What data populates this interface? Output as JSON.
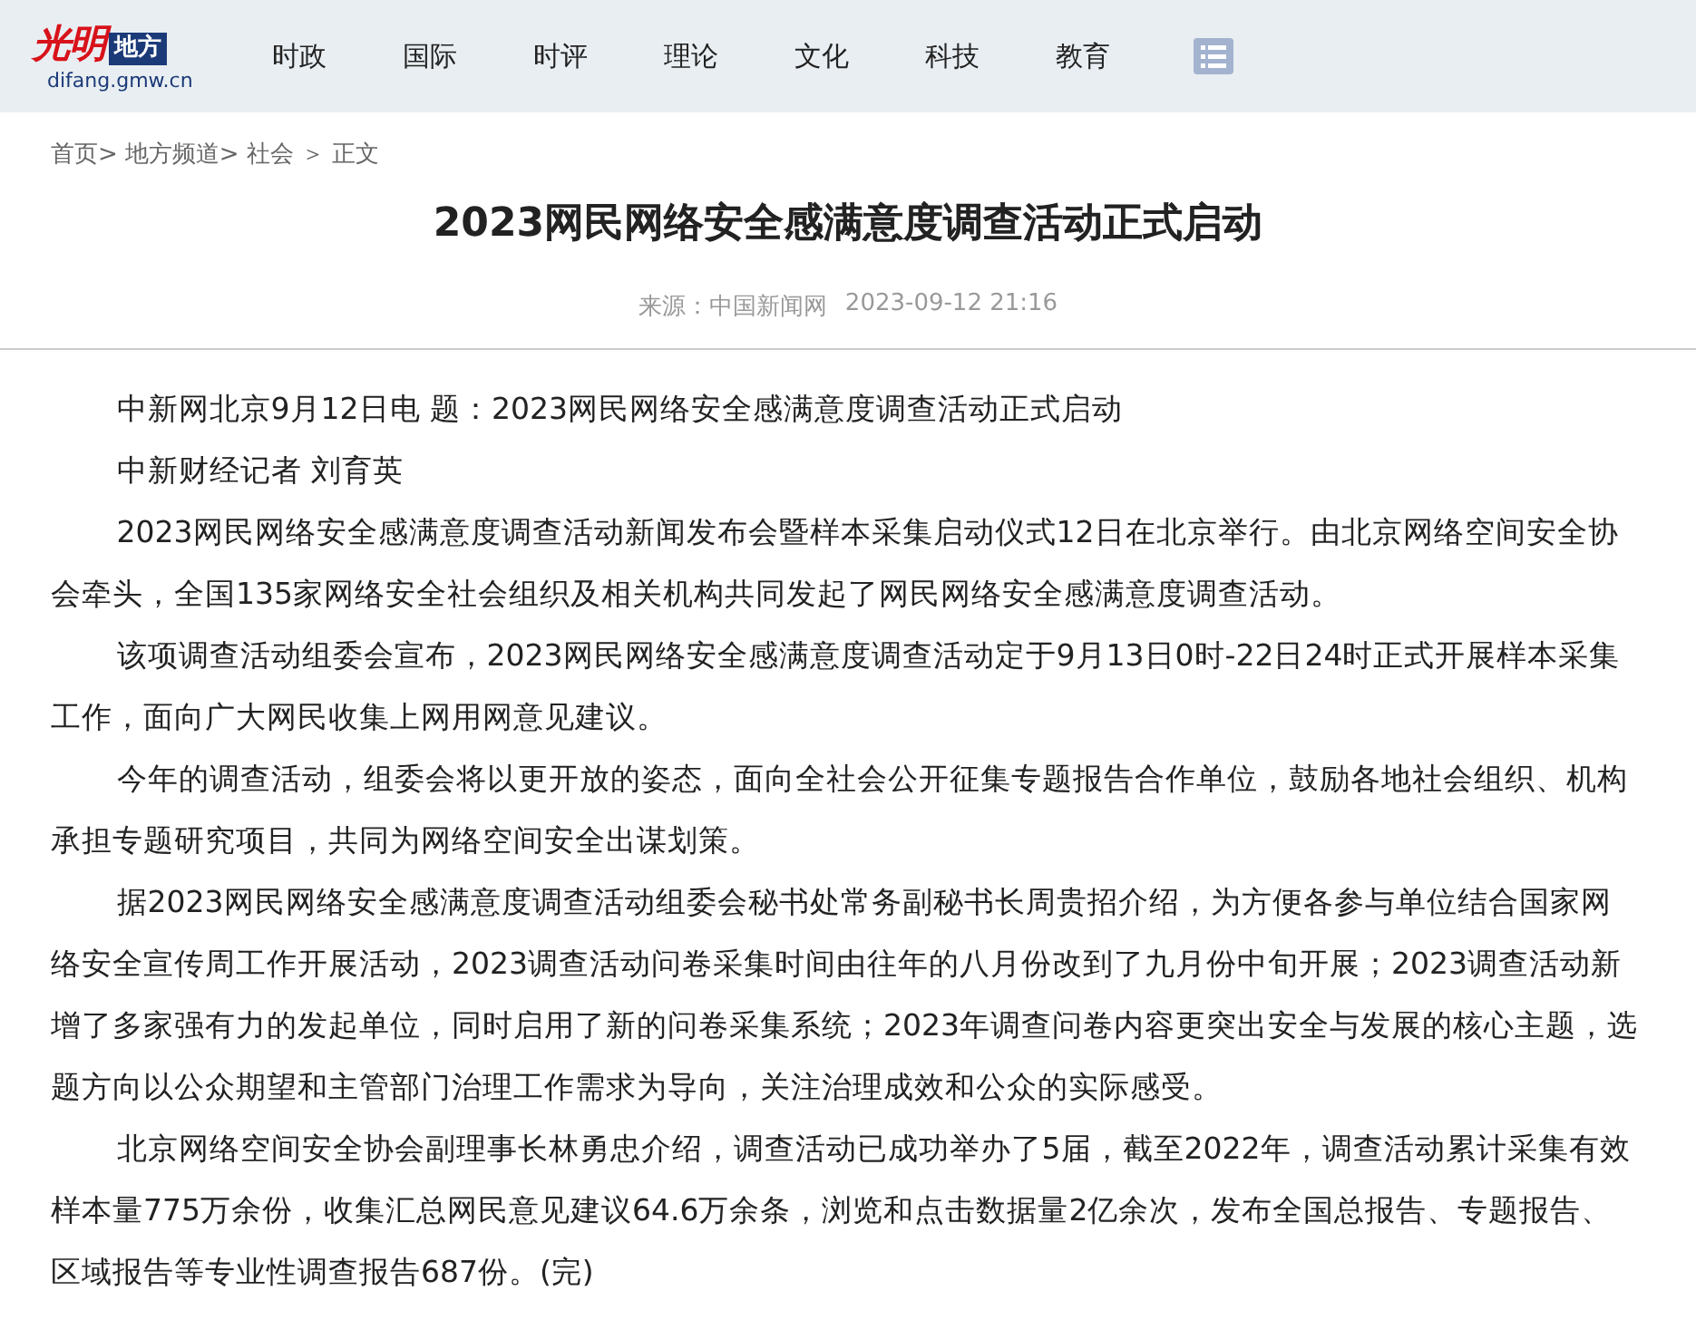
{
  "header": {
    "logo": {
      "mark": "光明",
      "badge": "地方",
      "domain": "difang.gmw.cn"
    },
    "nav": [
      {
        "label": "时政"
      },
      {
        "label": "国际"
      },
      {
        "label": "时评"
      },
      {
        "label": "理论"
      },
      {
        "label": "文化"
      },
      {
        "label": "科技"
      },
      {
        "label": "教育"
      }
    ]
  },
  "breadcrumb": [
    "首页>",
    "地方频道>",
    "社会",
    "＞",
    "正文"
  ],
  "article": {
    "title": "2023网民网络安全感满意度调查活动正式启动",
    "source": "来源：中国新闻网",
    "date": "2023-09-12 21:16",
    "paragraphs": [
      "中新网北京9月12日电 题：2023网民网络安全感满意度调查活动正式启动",
      "中新财经记者 刘育英",
      "2023网民网络安全感满意度调查活动新闻发布会暨样本采集启动仪式12日在北京举行。由北京网络空间安全协会牵头，全国135家网络安全社会组织及相关机构共同发起了网民网络安全感满意度调查活动。",
      "该项调查活动组委会宣布，2023网民网络安全感满意度调查活动定于9月13日0时-22日24时正式开展样本采集工作，面向广大网民收集上网用网意见建议。",
      "今年的调查活动，组委会将以更开放的姿态，面向全社会公开征集专题报告合作单位，鼓励各地社会组织、机构承担专题研究项目，共同为网络空间安全出谋划策。",
      "据2023网民网络安全感满意度调查活动组委会秘书处常务副秘书长周贵招介绍，为方便各参与单位结合国家网络安全宣传周工作开展活动，2023调查活动问卷采集时间由往年的八月份改到了九月份中旬开展；2023调查活动新增了多家强有力的发起单位，同时启用了新的问卷采集系统；2023年调查问卷内容更突出安全与发展的核心主题，选题方向以公众期望和主管部门治理工作需求为导向，关注治理成效和公众的实际感受。",
      "北京网络空间安全协会副理事长林勇忠介绍，调查活动已成功举办了5届，截至2022年，调查活动累计采集有效样本量775万余份，收集汇总网民意见建议64.6万余条，浏览和点击数据量2亿余次，发布全国总报告、专题报告、区域报告等专业性调查报告687份。(完)"
    ]
  }
}
